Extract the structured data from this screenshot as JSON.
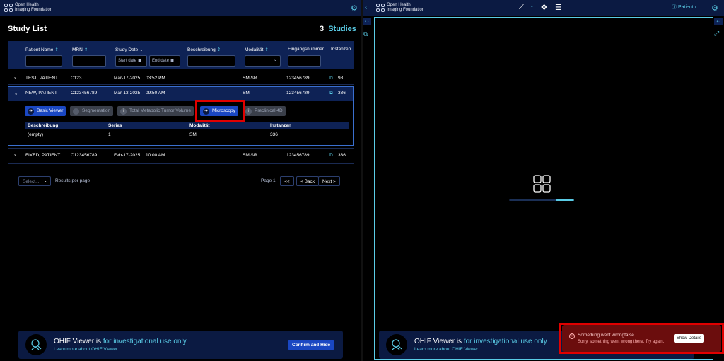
{
  "left_header": {
    "org_line1": "Open Health",
    "org_line2": "Imaging Foundation"
  },
  "study_list": {
    "title": "Study List",
    "count": "3",
    "count_label": "Studies",
    "columns": [
      "Patient Name",
      "MRN",
      "Study Date",
      "Beschreibung",
      "Modalität",
      "Eingangsnummer",
      "Instanzen"
    ],
    "filters": {
      "start_date": "Start date",
      "end_date": "End date"
    },
    "rows": [
      {
        "name": "TEST, PATIENT",
        "mrn": "C123",
        "date": "Mar-17-2025",
        "time": "03:52 PM",
        "modality": "SM\\SR",
        "accession": "123456789",
        "instances": "98"
      },
      {
        "name": "NEW, PATIENT",
        "mrn": "C123456789",
        "date": "Mar-13-2025",
        "time": "09:50 AM",
        "modality": "SM",
        "accession": "123456789",
        "instances": "336"
      },
      {
        "name": "FIXED, PATIENT",
        "mrn": "C123456789",
        "date": "Feb-17-2025",
        "time": "10:00 AM",
        "modality": "SM\\SR",
        "accession": "123456789",
        "instances": "336"
      }
    ],
    "workflows": [
      "Basic Viewer",
      "Segmentation",
      "Total Metabolic Tumor Volume",
      "Microscopy",
      "Preclinical 4D"
    ],
    "series_columns": [
      "Beschreibung",
      "Series",
      "Modalität",
      "Instanzen"
    ],
    "series_rows": [
      {
        "description": "(empty)",
        "series": "1",
        "modality": "SM",
        "instances": "336"
      }
    ]
  },
  "pagination": {
    "select_placeholder": "Select...",
    "results_per_page": "Results per page",
    "page_label": "Page 1",
    "first": "<<",
    "back": "< Back",
    "next": "Next >"
  },
  "banner": {
    "title_prefix": "OHIF Viewer is",
    "title_highlight": "for investigational use only",
    "learn_more": "Learn more about OHIF Viewer",
    "confirm": "Confirm and Hide"
  },
  "right_header": {
    "org_line1": "Open Health",
    "org_line2": "Imaging Foundation",
    "patient": "Patient"
  },
  "error_toast": {
    "title": "Something went wrongfalse.",
    "message": "Sorry, something went wrong there. Try again.",
    "button": "Show Details"
  },
  "colors": {
    "accent": "#5acce6",
    "header_bg": "#0b1a42",
    "primary_button": "#1a47c2",
    "highlight": "#e00000"
  }
}
